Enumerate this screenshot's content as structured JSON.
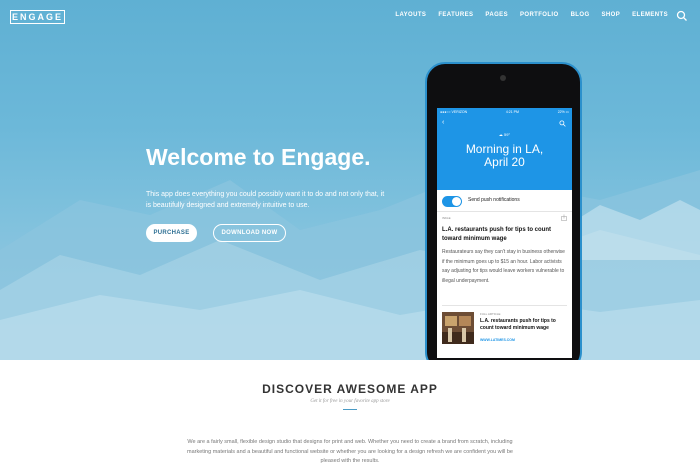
{
  "nav": {
    "logo": "ENGAGE",
    "links": [
      "LAYOUTS",
      "FEATURES",
      "PAGES",
      "PORTFOLIO",
      "BLOG",
      "SHOP",
      "ELEMENTS"
    ],
    "search_icon": "search-icon"
  },
  "hero": {
    "headline": "Welcome to Engage.",
    "subtext": "This app does everything you could possibly want it to do and not only that, it is beautifully designed and extremely intuitive to use.",
    "purchase_label": "PURCHASE",
    "download_label": "DOWNLOAD NOW"
  },
  "phone": {
    "carrier": "●●●○○ VERIZON",
    "time": "4:21 PM",
    "battery": "22% ▭",
    "weather": "☁ 59°",
    "greeting_line1": "Morning in LA,",
    "greeting_line2": "April 20",
    "push_label": "Send push notifications",
    "news_source": "INKLE",
    "news_title": "L.A. restaurants push for tips to count toward minimum wage",
    "news_body": "Restaurateurs say they can't stay in business otherwise if the minimum goes up to $15 an hour. Labor activists say adjusting for tips would leave workers vulnerable to illegal underpayment.",
    "mini_source": "FULL ARTICLE",
    "mini_title": "L.A. restaurants push for tips to count toward minimum wage",
    "mini_link": "WWW.LATIMES.COM"
  },
  "section": {
    "title": "DISCOVER AWESOME APP",
    "subtitle": "Get it for free in your favorite app store",
    "body": "We are a fairly small, flexible design studio that designs for print and web. Whether you need to create a brand from scratch, including marketing materials and a beautiful and functional website or whether you are looking for a design refresh we are confident you will be pleased with the results."
  },
  "colors": {
    "accent": "#1e95e6",
    "hero_bg": "#6cb8d9"
  }
}
